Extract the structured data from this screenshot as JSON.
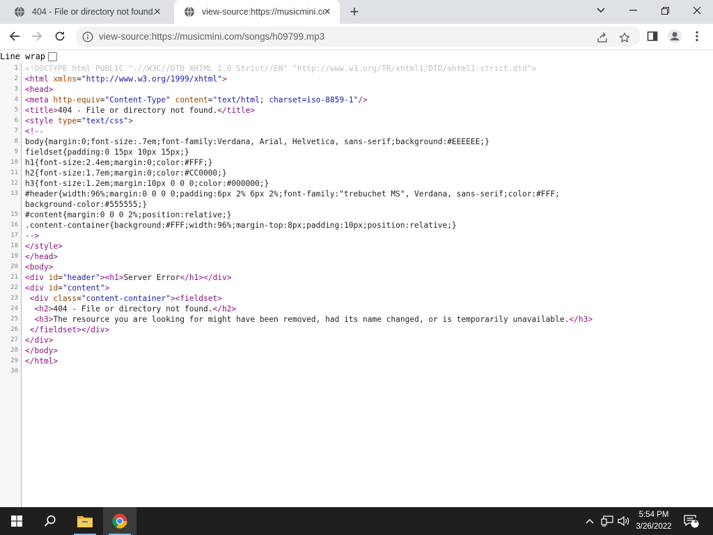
{
  "browser": {
    "tabs": [
      {
        "title": "404 - File or directory not found.",
        "active": false
      },
      {
        "title": "view-source:https://musicmini.co",
        "active": true
      }
    ],
    "address": "view-source:https://musicmini.com/songs/h09799.mp3"
  },
  "line_wrap_label": "Line wrap",
  "line_wrap_checked": false,
  "source_lines": [
    {
      "n": "1",
      "code": "<!DOCTYPE html PUBLIC \"-//W3C//DTD XHTML 1.0 Strict//EN\" \"http://www.w3.org/TR/xhtml1/DTD/xhtml1-strict.dtd\">"
    },
    {
      "n": "2",
      "code": "<html xmlns=\"http://www.w3.org/1999/xhtml\">"
    },
    {
      "n": "3",
      "code": "<head>"
    },
    {
      "n": "4",
      "code": "<meta http-equiv=\"Content-Type\" content=\"text/html; charset=iso-8859-1\"/>"
    },
    {
      "n": "5",
      "code": "<title>404 - File or directory not found.</title>"
    },
    {
      "n": "6",
      "code": "<style type=\"text/css\">"
    },
    {
      "n": "7",
      "code": "<!--"
    },
    {
      "n": "8",
      "code": "body{margin:0;font-size:.7em;font-family:Verdana, Arial, Helvetica, sans-serif;background:#EEEEEE;}"
    },
    {
      "n": "9",
      "code": "fieldset{padding:0 15px 10px 15px;}"
    },
    {
      "n": "10",
      "code": "h1{font-size:2.4em;margin:0;color:#FFF;}"
    },
    {
      "n": "11",
      "code": "h2{font-size:1.7em;margin:0;color:#CC0000;}"
    },
    {
      "n": "12",
      "code": "h3{font-size:1.2em;margin:10px 0 0 0;color:#000000;}"
    },
    {
      "n": "13",
      "code": "#header{width:96%;margin:0 0 0 0;padding:6px 2% 6px 2%;font-family:\"trebuchet MS\", Verdana, sans-serif;color:#FFF;"
    },
    {
      "n": "",
      "code": "background-color:#555555;}"
    },
    {
      "n": "15",
      "code": "#content{margin:0 0 0 2%;position:relative;}"
    },
    {
      "n": "16",
      "code": ".content-container{background:#FFF;width:96%;margin-top:8px;padding:10px;position:relative;}"
    },
    {
      "n": "17",
      "code": "-->"
    },
    {
      "n": "18",
      "code": "</style>"
    },
    {
      "n": "19",
      "code": "</head>"
    },
    {
      "n": "20",
      "code": "<body>"
    },
    {
      "n": "21",
      "code": "<div id=\"header\"><h1>Server Error</h1></div>"
    },
    {
      "n": "22",
      "code": "<div id=\"content\">"
    },
    {
      "n": "23",
      "code": " <div class=\"content-container\"><fieldset>"
    },
    {
      "n": "24",
      "code": "  <h2>404 - File or directory not found.</h2>"
    },
    {
      "n": "25",
      "code": "  <h3>The resource you are looking for might have been removed, had its name changed, or is temporarily unavailable.</h3>"
    },
    {
      "n": "26",
      "code": " </fieldset></div>"
    },
    {
      "n": "27",
      "code": "</div>"
    },
    {
      "n": "28",
      "code": "</body>"
    },
    {
      "n": "29",
      "code": "</html>"
    },
    {
      "n": "30",
      "code": ""
    }
  ],
  "taskbar": {
    "time": "5:54 PM",
    "date": "3/26/2022",
    "notification_count": "1"
  }
}
